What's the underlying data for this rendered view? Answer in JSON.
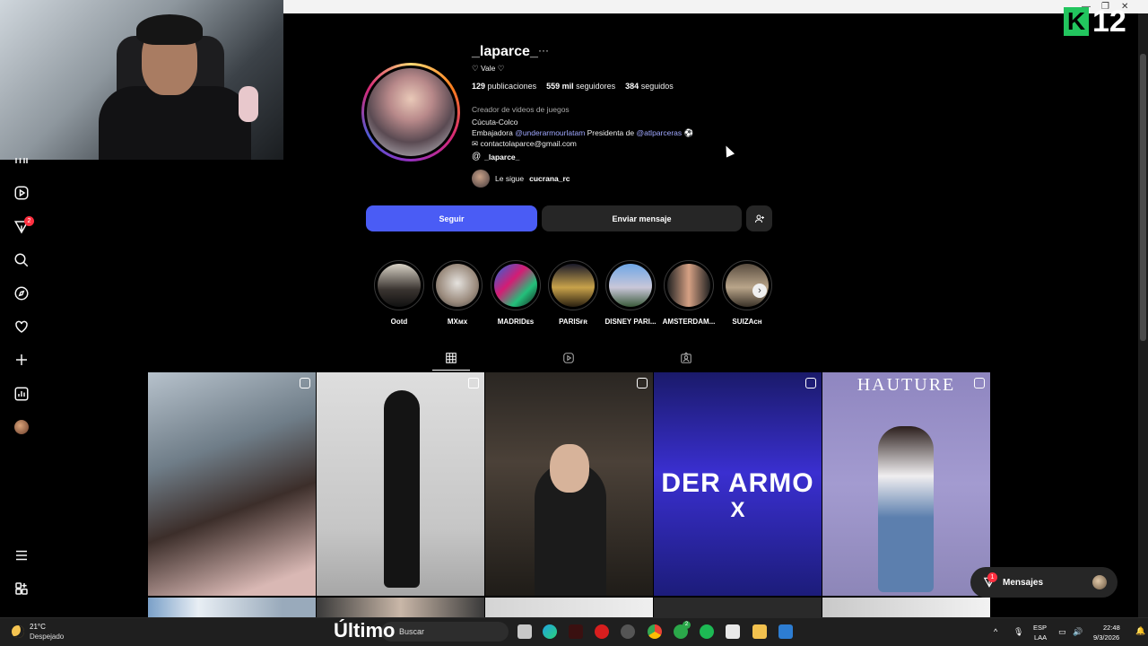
{
  "overlay": {
    "brand_letter": "K",
    "brand_number": "12"
  },
  "sidebar": {
    "notifications_count": "2"
  },
  "profile": {
    "username": "_laparce_",
    "more": "···",
    "nickname": "♡ Vale ♡",
    "stats": {
      "posts_value": "129",
      "posts_label": "publicaciones",
      "followers_value": "559 mil",
      "followers_label": "seguidores",
      "following_value": "384",
      "following_label": "seguidos"
    },
    "category": "Creador de videos de juegos",
    "bio": {
      "line1": "Cúcuta-Colco",
      "line2_prefix": "Embajadora ",
      "line2_link1": "@underarmourlatam",
      "line2_mid": " Presidenta de ",
      "line2_link2": "@atlparceras",
      "line2_emoji": "⚽",
      "email_icon": "✉",
      "email": "contactolaparce@gmail.com"
    },
    "threads_handle": "_laparce_",
    "followed_by_prefix": "Le sigue",
    "followed_by_user": "cucrana_rc"
  },
  "actions": {
    "follow_label": "Seguir",
    "message_label": "Enviar mensaje"
  },
  "highlights": [
    {
      "label": "Ootd"
    },
    {
      "label": "MXᴍx"
    },
    {
      "label": "MADRIDᴇs"
    },
    {
      "label": "PARISғʀ"
    },
    {
      "label": "DISNEY PARI..."
    },
    {
      "label": "AMSTERDAM..."
    },
    {
      "label": "SUIZAᴄʜ"
    }
  ],
  "highlights_next": "›",
  "posts": [
    {
      "overlay_text": ""
    },
    {
      "overlay_text": ""
    },
    {
      "overlay_text": ""
    },
    {
      "overlay_text": "DER ARMO",
      "overlay_text2": "X"
    },
    {
      "overlay_text": "HAUTURE"
    }
  ],
  "messages": {
    "label": "Mensajes",
    "badge": "1"
  },
  "taskbar": {
    "temperature": "21°C",
    "weather": "Despejado",
    "overlay_word": "Último",
    "search_placeholder": "Buscar",
    "lang_top": "ESP",
    "lang_bottom": "LAA",
    "time": "22:48",
    "date": "9/3/2026",
    "game_badge": "2"
  },
  "colors": {
    "follow_button": "#4a5cf5",
    "secondary_button": "#262626",
    "link": "#a0a8ff",
    "badge": "#ff3040",
    "brand_green": "#22c55e"
  }
}
